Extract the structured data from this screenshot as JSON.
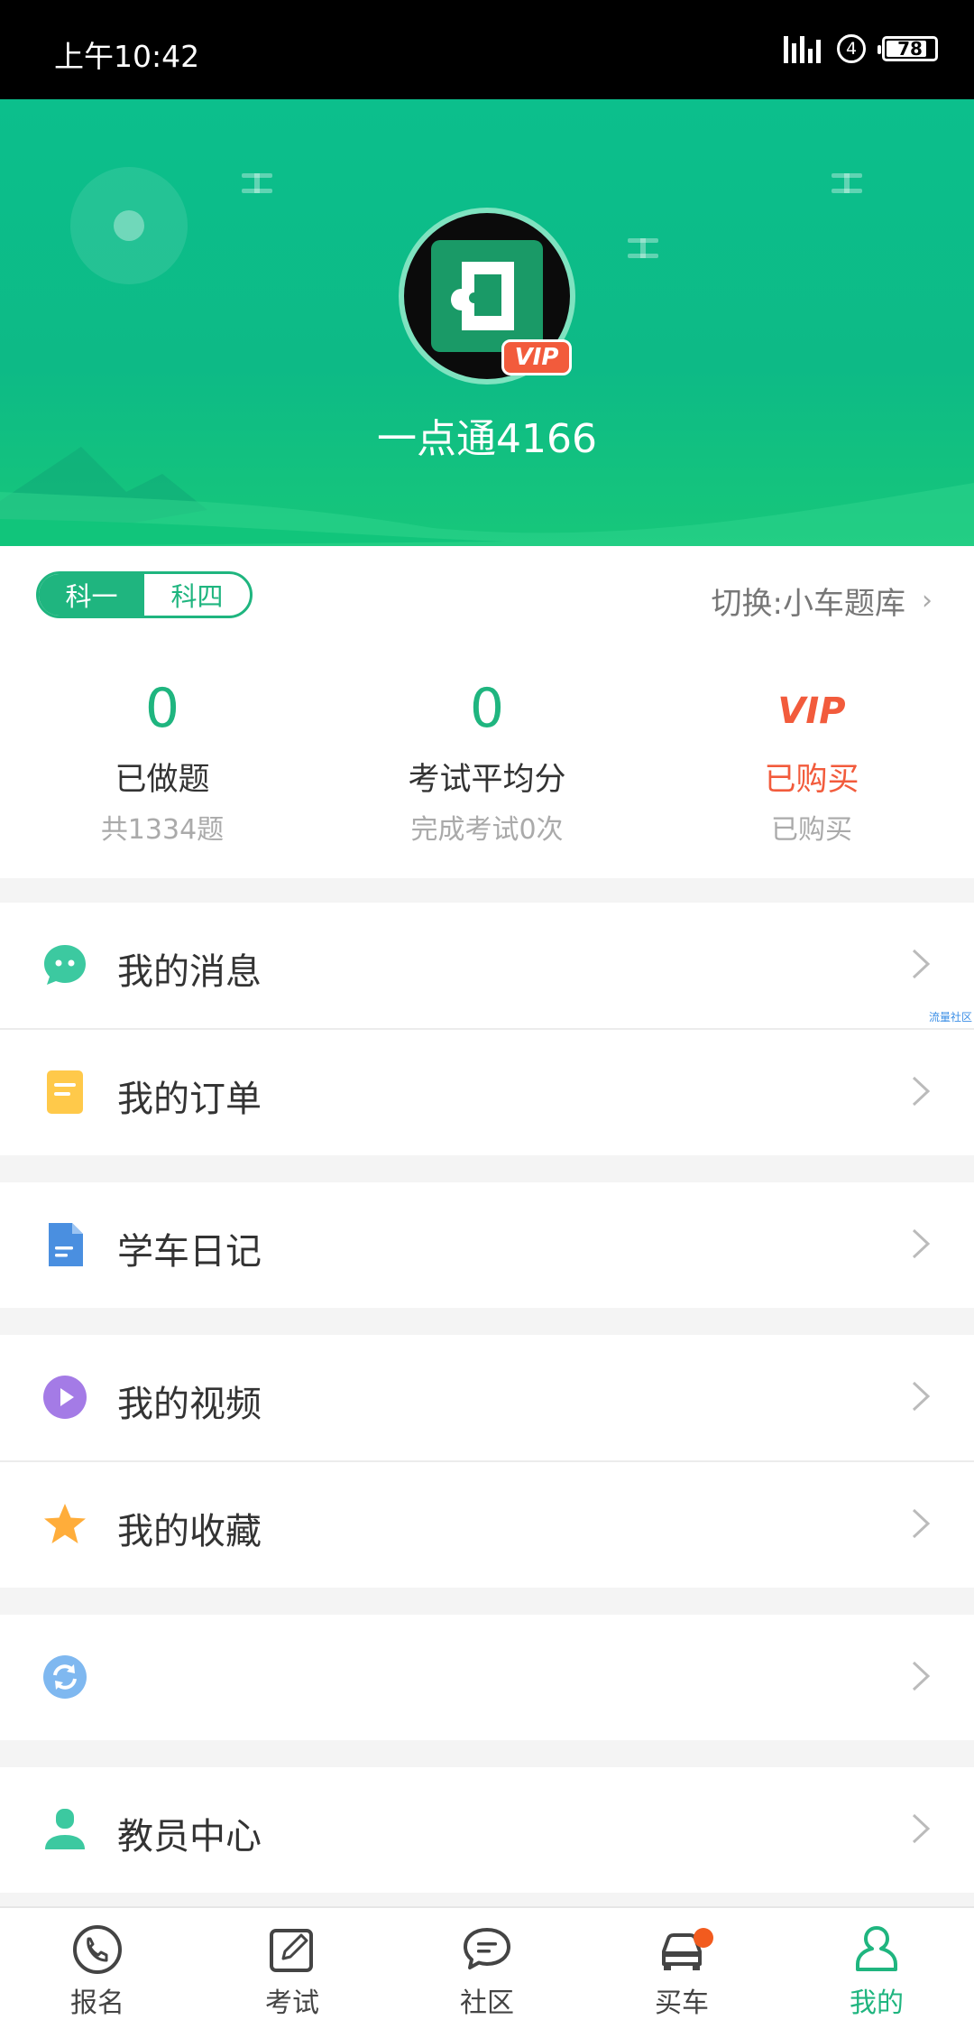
{
  "status_bar": {
    "time": "上午10:42",
    "sim_slot": "4",
    "battery": "78",
    "battery_level": 0.78
  },
  "profile": {
    "username": "一点通4166",
    "vip_badge": "VIP"
  },
  "subject_toggle": {
    "options": [
      "科一",
      "科四"
    ],
    "selected": "科一"
  },
  "switch_library": {
    "label": "切换:小车题库"
  },
  "stats": [
    {
      "value": "0",
      "label": "已做题",
      "sub": "共1334题"
    },
    {
      "value": "0",
      "label": "考试平均分",
      "sub": "完成考试0次"
    },
    {
      "logo": "VIP",
      "label": "已购买",
      "sub": "已购买"
    }
  ],
  "menu": [
    {
      "label": "我的消息",
      "icon": "chat-bubble-icon"
    },
    {
      "label": "我的订单",
      "icon": "order-note-icon"
    },
    {
      "label": "学车日记",
      "icon": "document-icon"
    },
    {
      "label": "我的视频",
      "icon": "play-circle-icon"
    },
    {
      "label": "我的收藏",
      "icon": "star-icon"
    },
    {
      "label": "",
      "icon": "refresh-icon"
    },
    {
      "label": "教员中心",
      "icon": "person-icon"
    }
  ],
  "watermark": "流量社区",
  "bottom_nav": [
    {
      "label": "报名",
      "icon": "phone-icon"
    },
    {
      "label": "考试",
      "icon": "edit-icon"
    },
    {
      "label": "社区",
      "icon": "comment-icon"
    },
    {
      "label": "买车",
      "icon": "car-icon",
      "has_dot": true
    },
    {
      "label": "我的",
      "icon": "profile-icon",
      "active": true
    }
  ],
  "colors": {
    "primary": "#1fb57f",
    "vip_red": "#f25b3c",
    "header_green": "#0cbf8c"
  }
}
